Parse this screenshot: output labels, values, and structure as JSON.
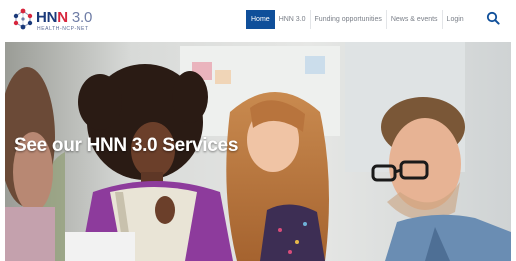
{
  "brand": {
    "name_prefix": "HN",
    "name_accent": "N",
    "name_version": " 3.0",
    "tagline": "HEALTH-NCP-NET"
  },
  "nav": {
    "items": [
      {
        "label": "Home",
        "active": true
      },
      {
        "label": "HNN 3.0",
        "active": false
      },
      {
        "label": "Funding opportunities",
        "active": false
      },
      {
        "label": "News & events",
        "active": false
      },
      {
        "label": "Login",
        "active": false
      }
    ],
    "search_icon": "search-icon"
  },
  "hero": {
    "title": "See our HNN 3.0 Services"
  },
  "colors": {
    "nav_active_bg": "#0f4f9a",
    "brand_blue": "#1b3a7a",
    "brand_red": "#d7263d"
  }
}
